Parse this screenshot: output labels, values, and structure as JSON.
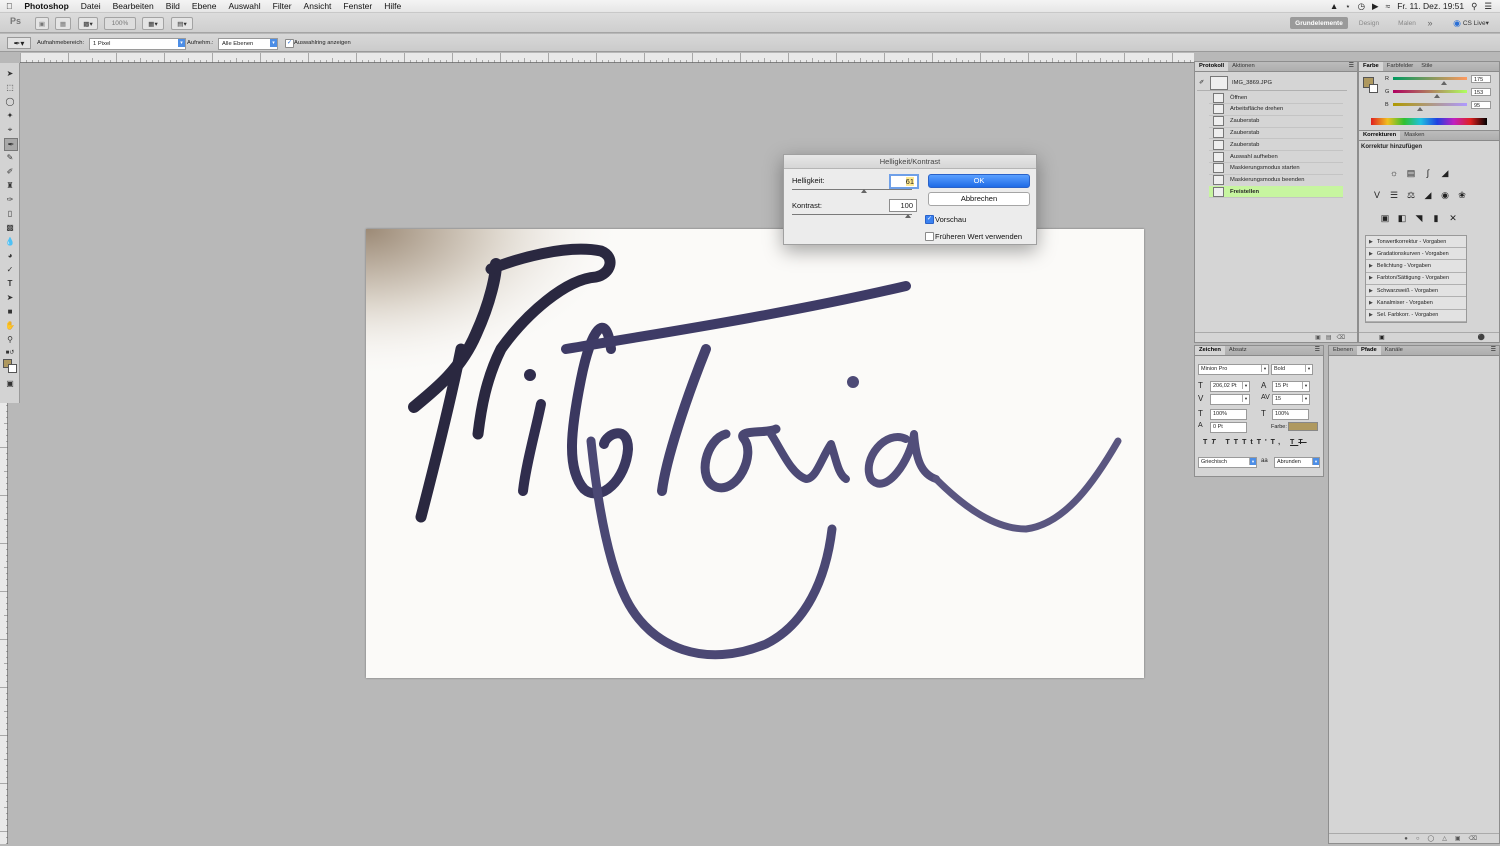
{
  "menubar": {
    "app_name": "Photoshop",
    "items": [
      "Datei",
      "Bearbeiten",
      "Bild",
      "Ebene",
      "Auswahl",
      "Filter",
      "Ansicht",
      "Fenster",
      "Hilfe"
    ],
    "clock": "Fr. 11. Dez.  19:51"
  },
  "appbar": {
    "ps_logo": "Ps",
    "zoom": "100%",
    "workspaces": [
      "Grundelemente",
      "Design",
      "Malen"
    ],
    "more": "»",
    "cslive": "CS Live"
  },
  "options": {
    "sample_size_label": "Aufnahmebereich:",
    "sample_size_value": "1 Pixel",
    "sample_label": "Aufnehm.:",
    "sample_value": "Alle Ebenen",
    "show_ring_label": "Auswahlring anzeigen"
  },
  "dialog": {
    "title": "Helligkeit/Kontrast",
    "brightness_label": "Helligkeit:",
    "brightness_value": "61",
    "brightness_level": 0.6,
    "contrast_label": "Kontrast:",
    "contrast_value": "100",
    "contrast_level": 0.97,
    "ok_label": "OK",
    "cancel_label": "Abbrechen",
    "preview_label": "Vorschau",
    "preview_checked": true,
    "legacy_label": "Früheren Wert verwenden",
    "legacy_checked": false
  },
  "history_panel": {
    "tabs": [
      "Protokoll",
      "Aktionen"
    ],
    "snapshot": "IMG_3869.JPG",
    "items": [
      "Öffnen",
      "Arbeitsfläche drehen",
      "Zauberstab",
      "Zauberstab",
      "Zauberstab",
      "Auswahl aufheben",
      "Maskierungsmodus starten",
      "Maskierungsmodus beenden",
      "Freistellen"
    ],
    "active_index": 8
  },
  "color_panel": {
    "tabs": [
      "Farbe",
      "Farbfelder",
      "Stile"
    ],
    "channels": [
      {
        "label": "R",
        "value": "175",
        "level": 0.69
      },
      {
        "label": "G",
        "value": "153",
        "level": 0.6
      },
      {
        "label": "B",
        "value": "95",
        "level": 0.37
      }
    ],
    "fg_color": "#af995f"
  },
  "adjustments_panel": {
    "tabs": [
      "Korrekturen",
      "Masken"
    ],
    "header": "Korrektur hinzufügen",
    "presets": [
      "Tonwertkorrektur - Vorgaben",
      "Gradationskurven - Vorgaben",
      "Belichtung - Vorgaben",
      "Farbton/Sättigung - Vorgaben",
      "Schwarzweiß - Vorgaben",
      "Kanalmixer - Vorgaben",
      "Sel. Farbkorr. - Vorgaben"
    ]
  },
  "character_panel": {
    "tabs": [
      "Zeichen",
      "Absatz"
    ],
    "font": "Minion Pro",
    "style": "Bold",
    "size": "206,02 Pt",
    "leading": "15 Pt",
    "tracking": "15",
    "vscale": "100%",
    "hscale": "100%",
    "baseline": "0 Pt",
    "color_label": "Farbe:",
    "language": "Griechisch",
    "aa": "aa",
    "antialias": "Abrunden"
  },
  "layers_panel": {
    "tabs": [
      "Ebenen",
      "Pfade",
      "Kanäle"
    ]
  }
}
